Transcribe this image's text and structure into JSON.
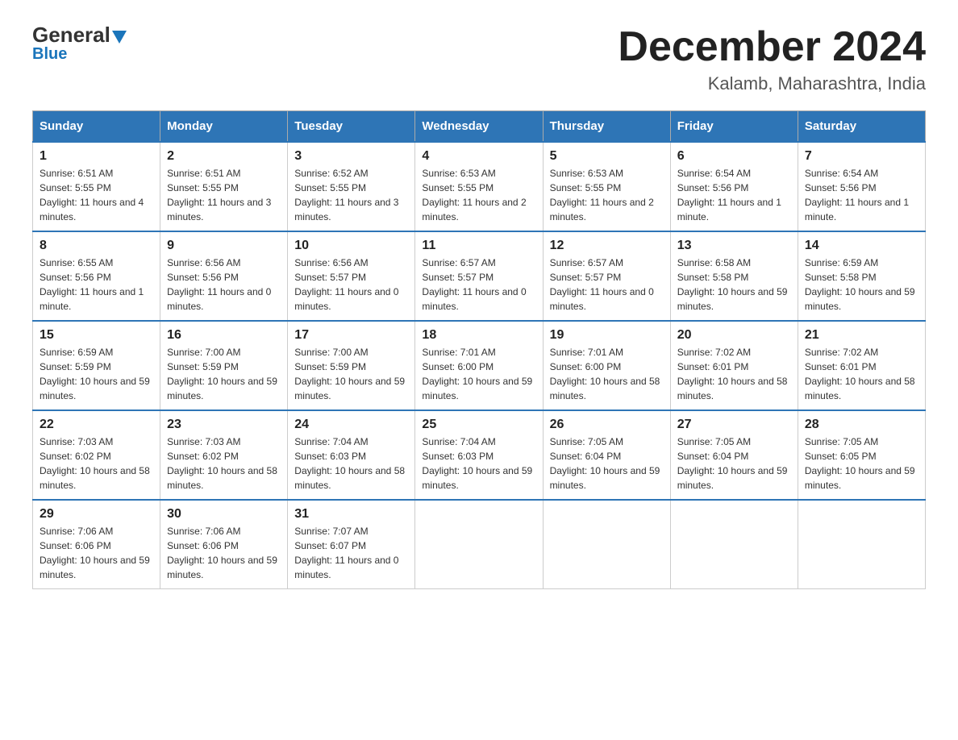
{
  "logo": {
    "general": "General",
    "blue": "Blue",
    "arrow_char": "▲"
  },
  "title": "December 2024",
  "subtitle": "Kalamb, Maharashtra, India",
  "weekdays": [
    "Sunday",
    "Monday",
    "Tuesday",
    "Wednesday",
    "Thursday",
    "Friday",
    "Saturday"
  ],
  "weeks": [
    [
      {
        "day": "1",
        "sunrise": "6:51 AM",
        "sunset": "5:55 PM",
        "daylight": "11 hours and 4 minutes."
      },
      {
        "day": "2",
        "sunrise": "6:51 AM",
        "sunset": "5:55 PM",
        "daylight": "11 hours and 3 minutes."
      },
      {
        "day": "3",
        "sunrise": "6:52 AM",
        "sunset": "5:55 PM",
        "daylight": "11 hours and 3 minutes."
      },
      {
        "day": "4",
        "sunrise": "6:53 AM",
        "sunset": "5:55 PM",
        "daylight": "11 hours and 2 minutes."
      },
      {
        "day": "5",
        "sunrise": "6:53 AM",
        "sunset": "5:55 PM",
        "daylight": "11 hours and 2 minutes."
      },
      {
        "day": "6",
        "sunrise": "6:54 AM",
        "sunset": "5:56 PM",
        "daylight": "11 hours and 1 minute."
      },
      {
        "day": "7",
        "sunrise": "6:54 AM",
        "sunset": "5:56 PM",
        "daylight": "11 hours and 1 minute."
      }
    ],
    [
      {
        "day": "8",
        "sunrise": "6:55 AM",
        "sunset": "5:56 PM",
        "daylight": "11 hours and 1 minute."
      },
      {
        "day": "9",
        "sunrise": "6:56 AM",
        "sunset": "5:56 PM",
        "daylight": "11 hours and 0 minutes."
      },
      {
        "day": "10",
        "sunrise": "6:56 AM",
        "sunset": "5:57 PM",
        "daylight": "11 hours and 0 minutes."
      },
      {
        "day": "11",
        "sunrise": "6:57 AM",
        "sunset": "5:57 PM",
        "daylight": "11 hours and 0 minutes."
      },
      {
        "day": "12",
        "sunrise": "6:57 AM",
        "sunset": "5:57 PM",
        "daylight": "11 hours and 0 minutes."
      },
      {
        "day": "13",
        "sunrise": "6:58 AM",
        "sunset": "5:58 PM",
        "daylight": "10 hours and 59 minutes."
      },
      {
        "day": "14",
        "sunrise": "6:59 AM",
        "sunset": "5:58 PM",
        "daylight": "10 hours and 59 minutes."
      }
    ],
    [
      {
        "day": "15",
        "sunrise": "6:59 AM",
        "sunset": "5:59 PM",
        "daylight": "10 hours and 59 minutes."
      },
      {
        "day": "16",
        "sunrise": "7:00 AM",
        "sunset": "5:59 PM",
        "daylight": "10 hours and 59 minutes."
      },
      {
        "day": "17",
        "sunrise": "7:00 AM",
        "sunset": "5:59 PM",
        "daylight": "10 hours and 59 minutes."
      },
      {
        "day": "18",
        "sunrise": "7:01 AM",
        "sunset": "6:00 PM",
        "daylight": "10 hours and 59 minutes."
      },
      {
        "day": "19",
        "sunrise": "7:01 AM",
        "sunset": "6:00 PM",
        "daylight": "10 hours and 58 minutes."
      },
      {
        "day": "20",
        "sunrise": "7:02 AM",
        "sunset": "6:01 PM",
        "daylight": "10 hours and 58 minutes."
      },
      {
        "day": "21",
        "sunrise": "7:02 AM",
        "sunset": "6:01 PM",
        "daylight": "10 hours and 58 minutes."
      }
    ],
    [
      {
        "day": "22",
        "sunrise": "7:03 AM",
        "sunset": "6:02 PM",
        "daylight": "10 hours and 58 minutes."
      },
      {
        "day": "23",
        "sunrise": "7:03 AM",
        "sunset": "6:02 PM",
        "daylight": "10 hours and 58 minutes."
      },
      {
        "day": "24",
        "sunrise": "7:04 AM",
        "sunset": "6:03 PM",
        "daylight": "10 hours and 58 minutes."
      },
      {
        "day": "25",
        "sunrise": "7:04 AM",
        "sunset": "6:03 PM",
        "daylight": "10 hours and 59 minutes."
      },
      {
        "day": "26",
        "sunrise": "7:05 AM",
        "sunset": "6:04 PM",
        "daylight": "10 hours and 59 minutes."
      },
      {
        "day": "27",
        "sunrise": "7:05 AM",
        "sunset": "6:04 PM",
        "daylight": "10 hours and 59 minutes."
      },
      {
        "day": "28",
        "sunrise": "7:05 AM",
        "sunset": "6:05 PM",
        "daylight": "10 hours and 59 minutes."
      }
    ],
    [
      {
        "day": "29",
        "sunrise": "7:06 AM",
        "sunset": "6:06 PM",
        "daylight": "10 hours and 59 minutes."
      },
      {
        "day": "30",
        "sunrise": "7:06 AM",
        "sunset": "6:06 PM",
        "daylight": "10 hours and 59 minutes."
      },
      {
        "day": "31",
        "sunrise": "7:07 AM",
        "sunset": "6:07 PM",
        "daylight": "11 hours and 0 minutes."
      },
      null,
      null,
      null,
      null
    ]
  ]
}
